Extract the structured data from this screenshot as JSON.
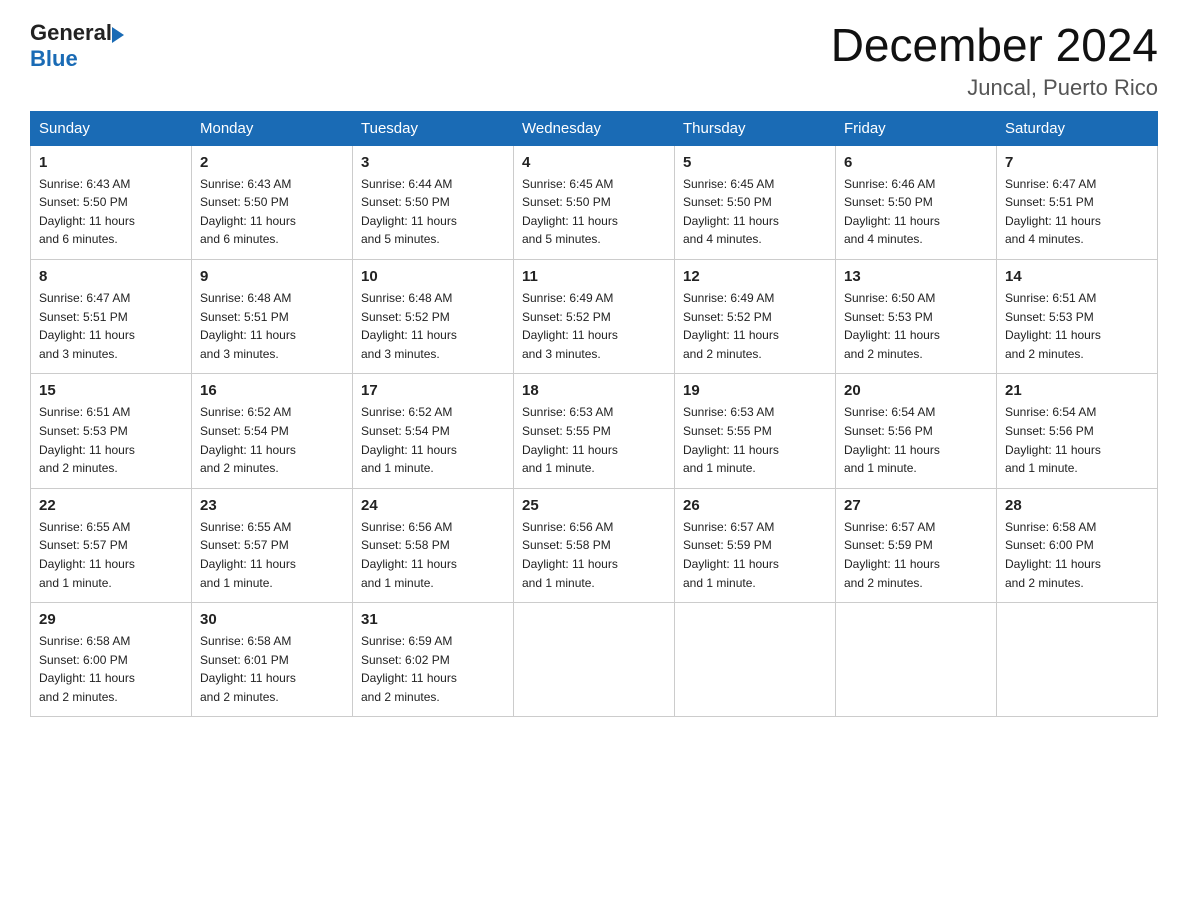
{
  "header": {
    "logo_general": "General",
    "logo_blue": "Blue",
    "month_title": "December 2024",
    "location": "Juncal, Puerto Rico"
  },
  "days_of_week": [
    "Sunday",
    "Monday",
    "Tuesday",
    "Wednesday",
    "Thursday",
    "Friday",
    "Saturday"
  ],
  "weeks": [
    [
      {
        "day": "1",
        "sunrise": "6:43 AM",
        "sunset": "5:50 PM",
        "daylight": "11 hours and 6 minutes."
      },
      {
        "day": "2",
        "sunrise": "6:43 AM",
        "sunset": "5:50 PM",
        "daylight": "11 hours and 6 minutes."
      },
      {
        "day": "3",
        "sunrise": "6:44 AM",
        "sunset": "5:50 PM",
        "daylight": "11 hours and 5 minutes."
      },
      {
        "day": "4",
        "sunrise": "6:45 AM",
        "sunset": "5:50 PM",
        "daylight": "11 hours and 5 minutes."
      },
      {
        "day": "5",
        "sunrise": "6:45 AM",
        "sunset": "5:50 PM",
        "daylight": "11 hours and 4 minutes."
      },
      {
        "day": "6",
        "sunrise": "6:46 AM",
        "sunset": "5:50 PM",
        "daylight": "11 hours and 4 minutes."
      },
      {
        "day": "7",
        "sunrise": "6:47 AM",
        "sunset": "5:51 PM",
        "daylight": "11 hours and 4 minutes."
      }
    ],
    [
      {
        "day": "8",
        "sunrise": "6:47 AM",
        "sunset": "5:51 PM",
        "daylight": "11 hours and 3 minutes."
      },
      {
        "day": "9",
        "sunrise": "6:48 AM",
        "sunset": "5:51 PM",
        "daylight": "11 hours and 3 minutes."
      },
      {
        "day": "10",
        "sunrise": "6:48 AM",
        "sunset": "5:52 PM",
        "daylight": "11 hours and 3 minutes."
      },
      {
        "day": "11",
        "sunrise": "6:49 AM",
        "sunset": "5:52 PM",
        "daylight": "11 hours and 3 minutes."
      },
      {
        "day": "12",
        "sunrise": "6:49 AM",
        "sunset": "5:52 PM",
        "daylight": "11 hours and 2 minutes."
      },
      {
        "day": "13",
        "sunrise": "6:50 AM",
        "sunset": "5:53 PM",
        "daylight": "11 hours and 2 minutes."
      },
      {
        "day": "14",
        "sunrise": "6:51 AM",
        "sunset": "5:53 PM",
        "daylight": "11 hours and 2 minutes."
      }
    ],
    [
      {
        "day": "15",
        "sunrise": "6:51 AM",
        "sunset": "5:53 PM",
        "daylight": "11 hours and 2 minutes."
      },
      {
        "day": "16",
        "sunrise": "6:52 AM",
        "sunset": "5:54 PM",
        "daylight": "11 hours and 2 minutes."
      },
      {
        "day": "17",
        "sunrise": "6:52 AM",
        "sunset": "5:54 PM",
        "daylight": "11 hours and 1 minute."
      },
      {
        "day": "18",
        "sunrise": "6:53 AM",
        "sunset": "5:55 PM",
        "daylight": "11 hours and 1 minute."
      },
      {
        "day": "19",
        "sunrise": "6:53 AM",
        "sunset": "5:55 PM",
        "daylight": "11 hours and 1 minute."
      },
      {
        "day": "20",
        "sunrise": "6:54 AM",
        "sunset": "5:56 PM",
        "daylight": "11 hours and 1 minute."
      },
      {
        "day": "21",
        "sunrise": "6:54 AM",
        "sunset": "5:56 PM",
        "daylight": "11 hours and 1 minute."
      }
    ],
    [
      {
        "day": "22",
        "sunrise": "6:55 AM",
        "sunset": "5:57 PM",
        "daylight": "11 hours and 1 minute."
      },
      {
        "day": "23",
        "sunrise": "6:55 AM",
        "sunset": "5:57 PM",
        "daylight": "11 hours and 1 minute."
      },
      {
        "day": "24",
        "sunrise": "6:56 AM",
        "sunset": "5:58 PM",
        "daylight": "11 hours and 1 minute."
      },
      {
        "day": "25",
        "sunrise": "6:56 AM",
        "sunset": "5:58 PM",
        "daylight": "11 hours and 1 minute."
      },
      {
        "day": "26",
        "sunrise": "6:57 AM",
        "sunset": "5:59 PM",
        "daylight": "11 hours and 1 minute."
      },
      {
        "day": "27",
        "sunrise": "6:57 AM",
        "sunset": "5:59 PM",
        "daylight": "11 hours and 2 minutes."
      },
      {
        "day": "28",
        "sunrise": "6:58 AM",
        "sunset": "6:00 PM",
        "daylight": "11 hours and 2 minutes."
      }
    ],
    [
      {
        "day": "29",
        "sunrise": "6:58 AM",
        "sunset": "6:00 PM",
        "daylight": "11 hours and 2 minutes."
      },
      {
        "day": "30",
        "sunrise": "6:58 AM",
        "sunset": "6:01 PM",
        "daylight": "11 hours and 2 minutes."
      },
      {
        "day": "31",
        "sunrise": "6:59 AM",
        "sunset": "6:02 PM",
        "daylight": "11 hours and 2 minutes."
      },
      null,
      null,
      null,
      null
    ]
  ],
  "labels": {
    "sunrise": "Sunrise:",
    "sunset": "Sunset:",
    "daylight": "Daylight:"
  }
}
